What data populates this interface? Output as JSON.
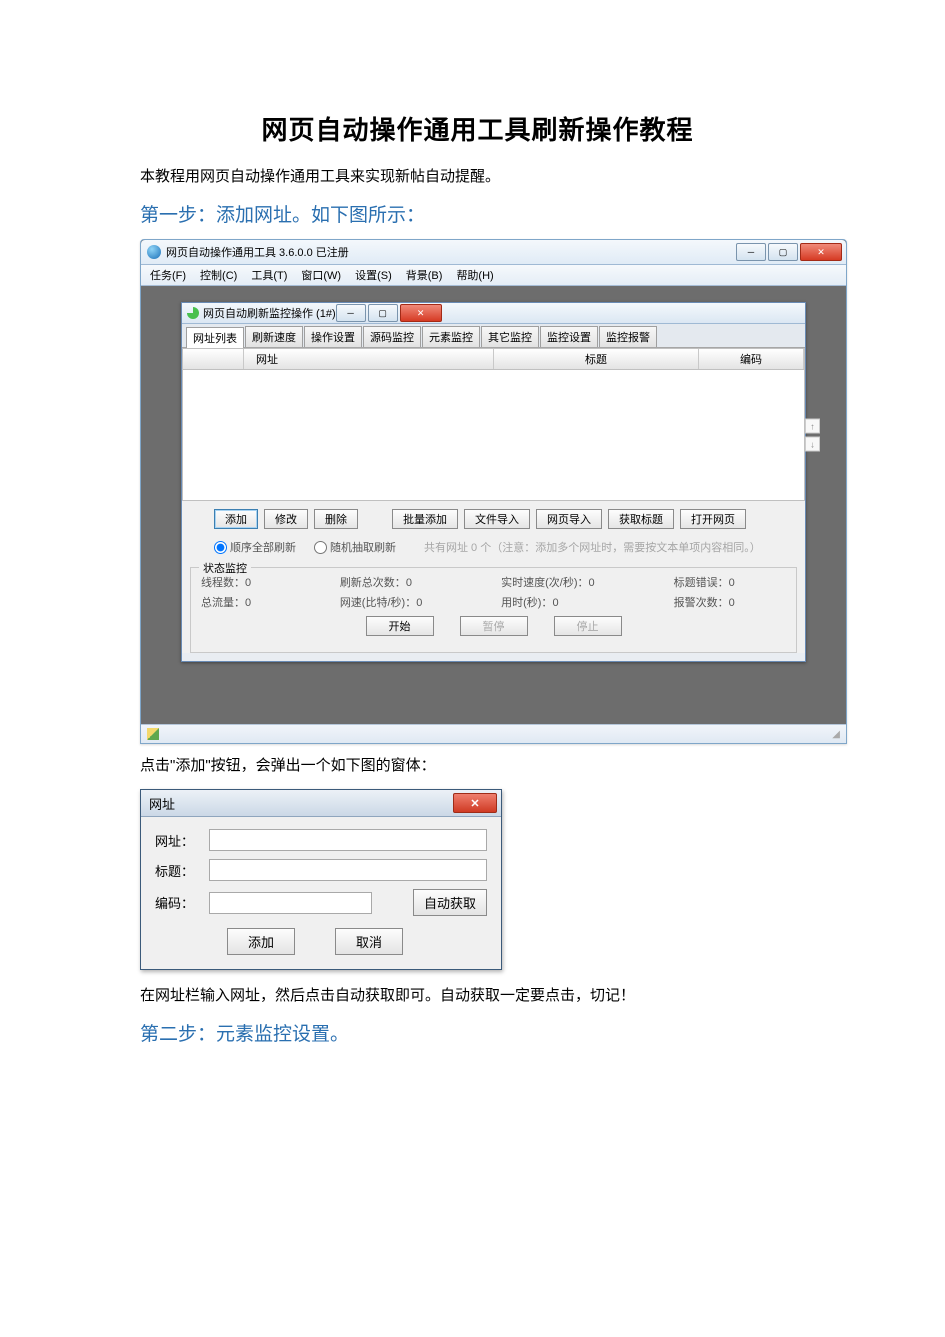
{
  "document": {
    "title": "网页自动操作通用工具刷新操作教程",
    "intro": "本教程用网页自动操作通用工具来实现新帖自动提醒。",
    "step1_heading": "第一步：添加网址。如下图所示：",
    "click_add_text": "点击\"添加\"按钮，会弹出一个如下图的窗体：",
    "after_dialog_text": "在网址栏输入网址，然后点击自动获取即可。自动获取一定要点击，切记！",
    "step2_heading": "第二步：元素监控设置。"
  },
  "app": {
    "title": "网页自动操作通用工具 3.6.0.0  已注册",
    "menus": [
      "任务(F)",
      "控制(C)",
      "工具(T)",
      "窗口(W)",
      "设置(S)",
      "背景(B)",
      "帮助(H)"
    ],
    "child_title": "网页自动刷新监控操作 (1#)",
    "tabs": [
      "网址列表",
      "刷新速度",
      "操作设置",
      "源码监控",
      "元素监控",
      "其它监控",
      "监控设置",
      "监控报警"
    ],
    "columns": {
      "url": "网址",
      "title": "标题",
      "encoding": "编码"
    },
    "buttons": {
      "add": "添加",
      "edit": "修改",
      "delete": "删除",
      "batch_add": "批量添加",
      "file_import": "文件导入",
      "web_import": "网页导入",
      "get_title": "获取标题",
      "open_page": "打开网页"
    },
    "radio": {
      "sequential": "顺序全部刷新",
      "random": "随机抽取刷新"
    },
    "hint": "共有网址 0 个（注意：添加多个网址时，需要按文本单项内容相同。）",
    "status": {
      "legend": "状态监控",
      "threads_label": "线程数：",
      "threads_value": "0",
      "total_refresh_label": "刷新总次数：",
      "total_refresh_value": "0",
      "speed_label": "实时速度(次/秒)：",
      "speed_value": "0",
      "title_err_label": "标题错误：",
      "title_err_value": "0",
      "traffic_label": "总流量：",
      "traffic_value": "0",
      "net_label": "网速(比特/秒)：",
      "net_value": "0",
      "time_label": "用时(秒)：",
      "time_value": "0",
      "alert_label": "报警次数：",
      "alert_value": "0"
    },
    "controls": {
      "start": "开始",
      "pause": "暂停",
      "stop": "停止"
    }
  },
  "dialog": {
    "title": "网址",
    "url_label": "网址：",
    "title_label": "标题：",
    "encoding_label": "编码：",
    "auto_get": "自动获取",
    "add": "添加",
    "cancel": "取消"
  }
}
